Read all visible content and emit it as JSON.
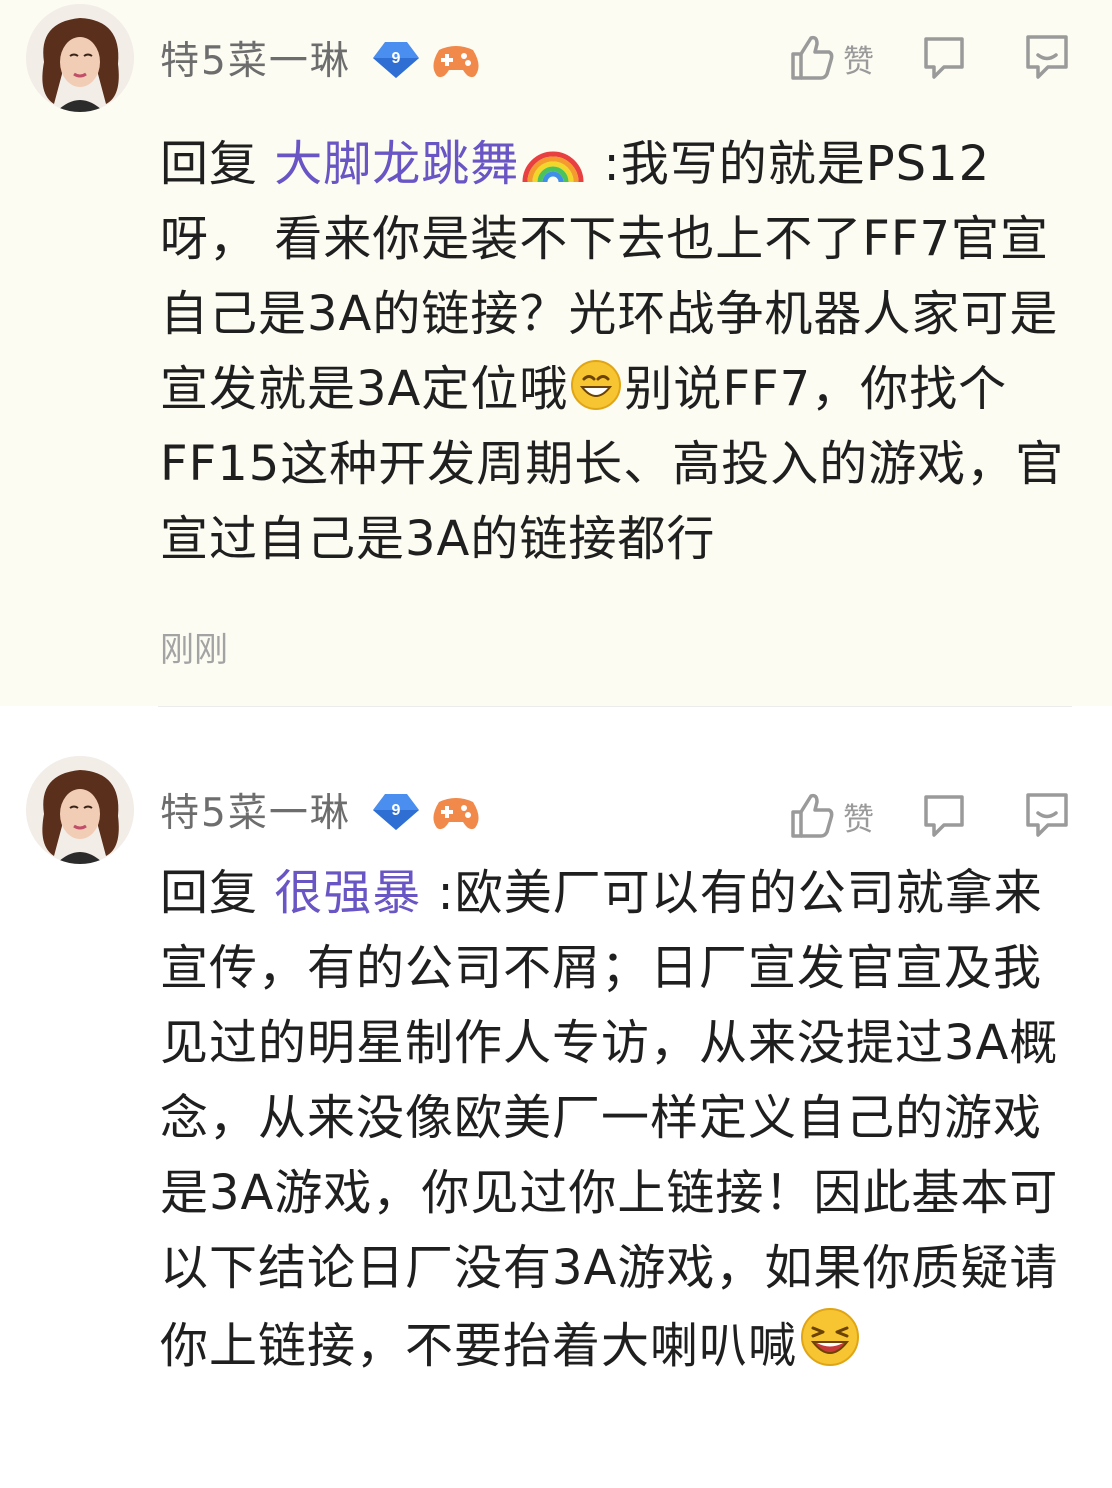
{
  "comments": [
    {
      "username": "特5菜一琳",
      "level": "9",
      "like_label": "赞",
      "reply_prefix": "回复",
      "mention": "大脚龙跳舞",
      "text_before_emoji": " :我写的就是PS12呀， 看来你是装不下去也上不了FF7官宣自己是3A的链接？光环战争机器人家可是宣发就是3A定位哦",
      "text_after_emoji": "别说FF7，你找个FF15这种开发周期长、高投入的游戏，官宣过自己是3A的链接都行",
      "timestamp": "刚刚",
      "icons": {
        "mention_suffix": "rainbow-icon",
        "inline": "grin-face-icon"
      }
    },
    {
      "username": "特5菜一琳",
      "level": "9",
      "like_label": "赞",
      "reply_prefix": "回复",
      "mention": "很强暴",
      "text_before_emoji": " :欧美厂可以有的公司就拿来宣传，有的公司不屑；日厂宣发官宣及我见过的明星制作人专访，从来没提过3A概念，从来没像欧美厂一样定义自己的游戏是3A游戏，你见过你上链接！因此基本可以下结论日厂没有3A游戏，如果你质疑请你上链接，不要抬着大喇叭喊",
      "text_after_emoji": "",
      "icons": {
        "inline": "laughing-face-icon"
      }
    }
  ],
  "colors": {
    "mention": "#6a55c4",
    "username": "#6d6d6d",
    "highlight_bg": "#fcfcf3",
    "level_badge": "#4a8ef0",
    "game_badge": "#f0894a"
  }
}
